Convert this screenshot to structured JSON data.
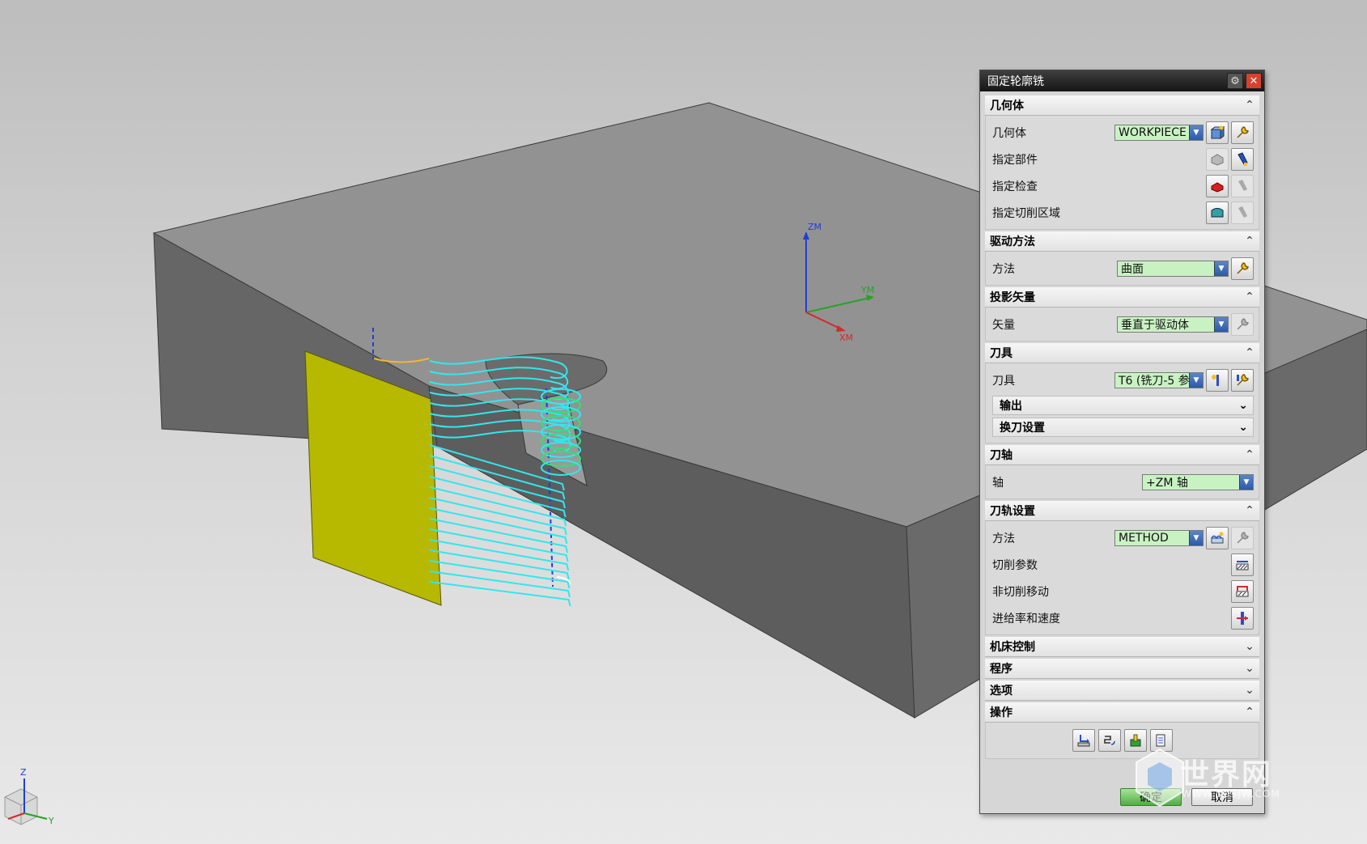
{
  "dialog": {
    "title": "固定轮廓铣",
    "sections": {
      "geometry": {
        "header": "几何体",
        "rows": {
          "geometry": {
            "label": "几何体",
            "value": "WORKPIECE"
          },
          "part": {
            "label": "指定部件"
          },
          "check": {
            "label": "指定检查"
          },
          "cut_area": {
            "label": "指定切削区域"
          }
        }
      },
      "drive": {
        "header": "驱动方法",
        "method_label": "方法",
        "method_value": "曲面"
      },
      "projection": {
        "header": "投影矢量",
        "vector_label": "矢量",
        "vector_value": "垂直于驱动体"
      },
      "tool": {
        "header": "刀具",
        "tool_label": "刀具",
        "tool_value": "T6 (铣刀-5 参",
        "output_label": "输出",
        "tool_change_label": "换刀设置"
      },
      "axis": {
        "header": "刀轴",
        "axis_label": "轴",
        "axis_value": "+ZM 轴"
      },
      "path": {
        "header": "刀轨设置",
        "method_label": "方法",
        "method_value": "METHOD",
        "cut_params_label": "切削参数",
        "non_cut_label": "非切削移动",
        "feeds_label": "进给率和速度"
      },
      "machine_control": {
        "header": "机床控制"
      },
      "program": {
        "header": "程序"
      },
      "options": {
        "header": "选项"
      },
      "actions": {
        "header": "操作"
      }
    },
    "ok_label": "确定",
    "cancel_label": "取消"
  },
  "viewport": {
    "wcs_labels": {
      "zm": "ZM",
      "ym": "YM",
      "xm": "XM"
    },
    "triad_labels": {
      "z": "Z",
      "y": "Y"
    }
  },
  "watermark": {
    "text": "世界网",
    "url": "WWW.3DSJW.COM"
  },
  "colors": {
    "toolpath": "#2fe8ef",
    "drive_surface": "#b7b800",
    "block_top": "#929292",
    "block_front": "#5f5f5f",
    "block_side": "#6c6c6c",
    "dropdown_bg": "#c9f2c3",
    "title_bar": "#1c1c1c",
    "close": "#d8412c"
  }
}
